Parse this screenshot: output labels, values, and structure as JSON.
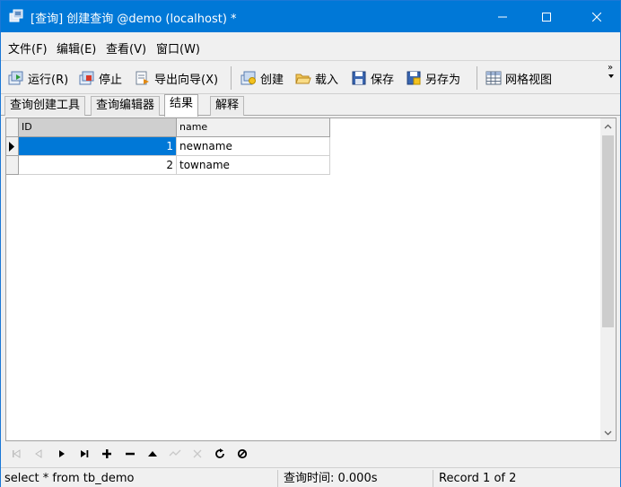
{
  "window": {
    "title": "[查询] 创建查询 @demo (localhost) *",
    "controls": {
      "minimize": "minimize",
      "maximize": "maximize",
      "close": "close"
    }
  },
  "menu": {
    "items": [
      {
        "label": "文件(F)"
      },
      {
        "label": "编辑(E)"
      },
      {
        "label": "查看(V)"
      },
      {
        "label": "窗口(W)"
      }
    ]
  },
  "toolbar": {
    "run": "运行(R)",
    "stop": "停止",
    "export_wizard": "导出向导(X)",
    "create": "创建",
    "load": "载入",
    "save": "保存",
    "save_as": "另存为",
    "grid_view": "网格视图",
    "more": "»"
  },
  "tabs": [
    {
      "label": "查询创建工具",
      "active": false
    },
    {
      "label": "查询编辑器",
      "active": false
    },
    {
      "label": "结果",
      "active": true
    },
    {
      "label": "解释",
      "active": false
    }
  ],
  "grid": {
    "columns": [
      "ID",
      "name"
    ],
    "rows": [
      {
        "id": "1",
        "name": "newname",
        "selected": true
      },
      {
        "id": "2",
        "name": "towname",
        "selected": false
      }
    ]
  },
  "navigator": {
    "buttons": [
      "first-icon",
      "prior-icon",
      "next-icon",
      "last-icon",
      "insert-icon",
      "delete-icon",
      "edit-icon",
      "post-icon",
      "cancel-icon",
      "refresh-icon",
      "stop-icon"
    ]
  },
  "status": {
    "sql": "select * from tb_demo",
    "query_time": "查询时间: 0.000s",
    "record": "Record 1 of 2"
  },
  "colors": {
    "titlebar": "#0078d7",
    "selection": "#0078d7"
  }
}
